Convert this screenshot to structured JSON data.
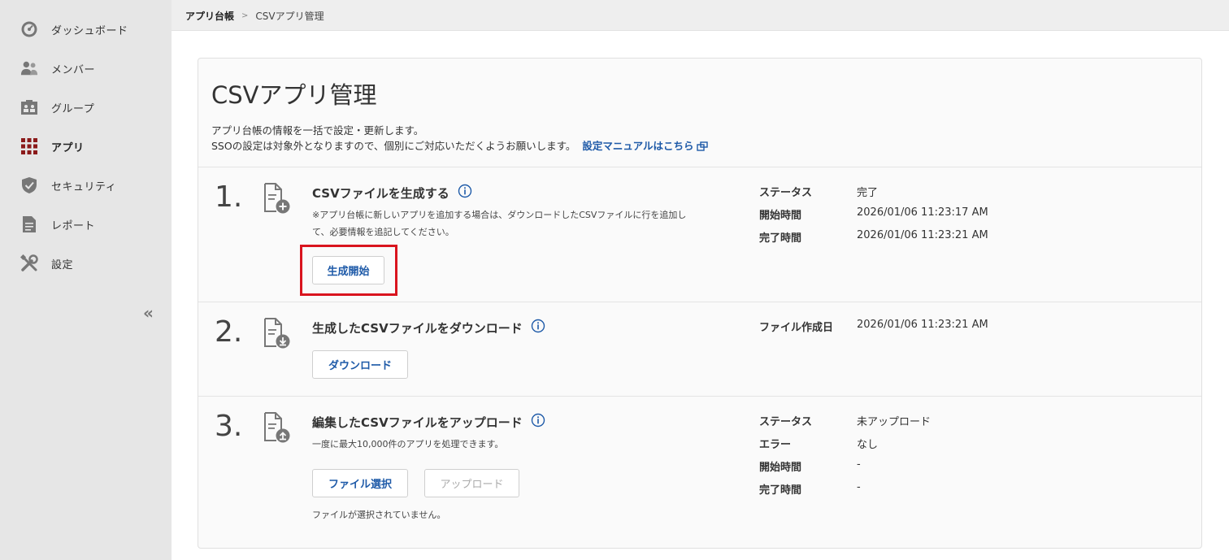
{
  "sidebar": {
    "items": [
      {
        "label": "ダッシュボード",
        "icon": "dashboard-icon"
      },
      {
        "label": "メンバー",
        "icon": "members-icon"
      },
      {
        "label": "グループ",
        "icon": "group-icon"
      },
      {
        "label": "アプリ",
        "icon": "apps-grid-icon",
        "active": true
      },
      {
        "label": "セキュリティ",
        "icon": "shield-icon"
      },
      {
        "label": "レポート",
        "icon": "report-icon"
      },
      {
        "label": "設定",
        "icon": "tools-icon"
      }
    ],
    "collapse_label": "«"
  },
  "breadcrumb": {
    "parent": "アプリ台帳",
    "separator": ">",
    "current": "CSVアプリ管理"
  },
  "page": {
    "title": "CSVアプリ管理",
    "description_line1": "アプリ台帳の情報を一括で設定・更新します。",
    "description_line2": "SSOの設定は対象外となりますので、個別にご対応いただくようお願いします。",
    "manual_link": "設定マニュアルはこちら"
  },
  "steps": {
    "generate": {
      "number": "1.",
      "title": "CSVファイルを生成する",
      "note_line1": "※アプリ台帳に新しいアプリを追加する場合は、ダウンロードしたCSVファイルに行を追加し",
      "note_line2": "て、必要情報を追記してください。",
      "button": "生成開始",
      "status_label": "ステータス",
      "status_value": "完了",
      "start_label": "開始時間",
      "start_value": "2026/01/06 11:23:17 AM",
      "end_label": "完了時間",
      "end_value": "2026/01/06 11:23:21 AM"
    },
    "download": {
      "number": "2.",
      "title": "生成したCSVファイルをダウンロード",
      "button": "ダウンロード",
      "created_label": "ファイル作成日",
      "created_value": "2026/01/06 11:23:21 AM"
    },
    "upload": {
      "number": "3.",
      "title": "編集したCSVファイルをアップロード",
      "note": "一度に最大10,000件のアプリを処理できます。",
      "select_button": "ファイル選択",
      "upload_button": "アップロード",
      "file_message": "ファイルが選択されていません。",
      "status_label": "ステータス",
      "status_value": "未アップロード",
      "error_label": "エラー",
      "error_value": "なし",
      "start_label": "開始時間",
      "start_value": "-",
      "end_label": "完了時間",
      "end_value": "-"
    }
  },
  "colors": {
    "accent": "#1e5aa8",
    "active_icon": "#8b1a1a",
    "highlight": "#d9141e"
  }
}
